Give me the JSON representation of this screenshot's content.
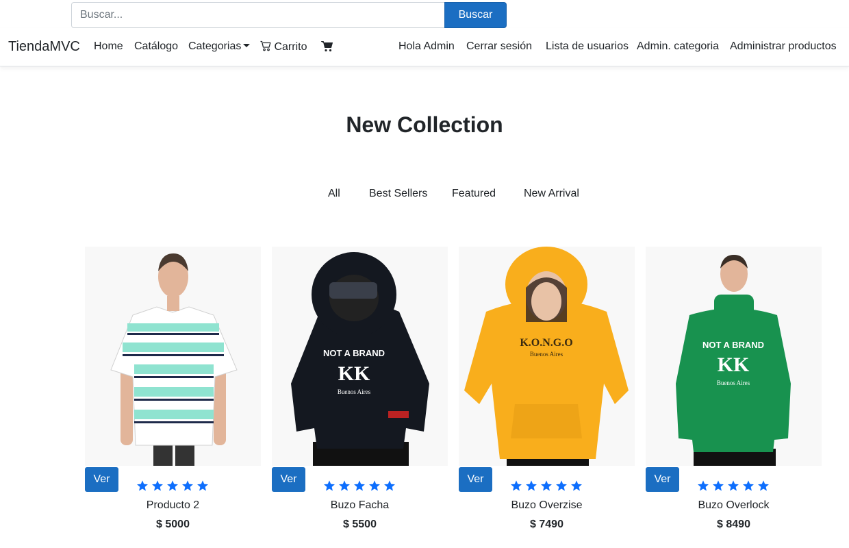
{
  "search": {
    "placeholder": "Buscar...",
    "button_label": "Buscar"
  },
  "navbar": {
    "brand": "TiendaMVC",
    "left_items": [
      "Home",
      "Catálogo",
      "Categorias",
      "Carrito"
    ],
    "right_items": [
      "Hola Admin",
      "Cerrar sesión",
      "Lista de usuarios",
      "Admin. categoria",
      "Administrar productos"
    ]
  },
  "main": {
    "title": "New Collection",
    "filters": [
      "All",
      "Best Sellers",
      "Featured",
      "New Arrival"
    ]
  },
  "products": [
    {
      "name": "Producto 2",
      "price": "$ 5000",
      "button": "Ver",
      "rating": 5,
      "image": "striped-tshirt"
    },
    {
      "name": "Buzo Facha",
      "price": "$ 5500",
      "button": "Ver",
      "rating": 5,
      "image": "black-hoodie"
    },
    {
      "name": "Buzo Overzise",
      "price": "$ 7490",
      "button": "Ver",
      "rating": 5,
      "image": "yellow-hoodie"
    },
    {
      "name": "Buzo Overlock",
      "price": "$ 8490",
      "button": "Ver",
      "rating": 5,
      "image": "green-hoodie"
    }
  ],
  "colors": {
    "primary": "#1b6ec2",
    "star": "#0d6efd",
    "text": "#212529",
    "border": "#dee2e6"
  },
  "icons": [
    "cart-outline-icon",
    "cart-filled-icon",
    "star-icon"
  ]
}
